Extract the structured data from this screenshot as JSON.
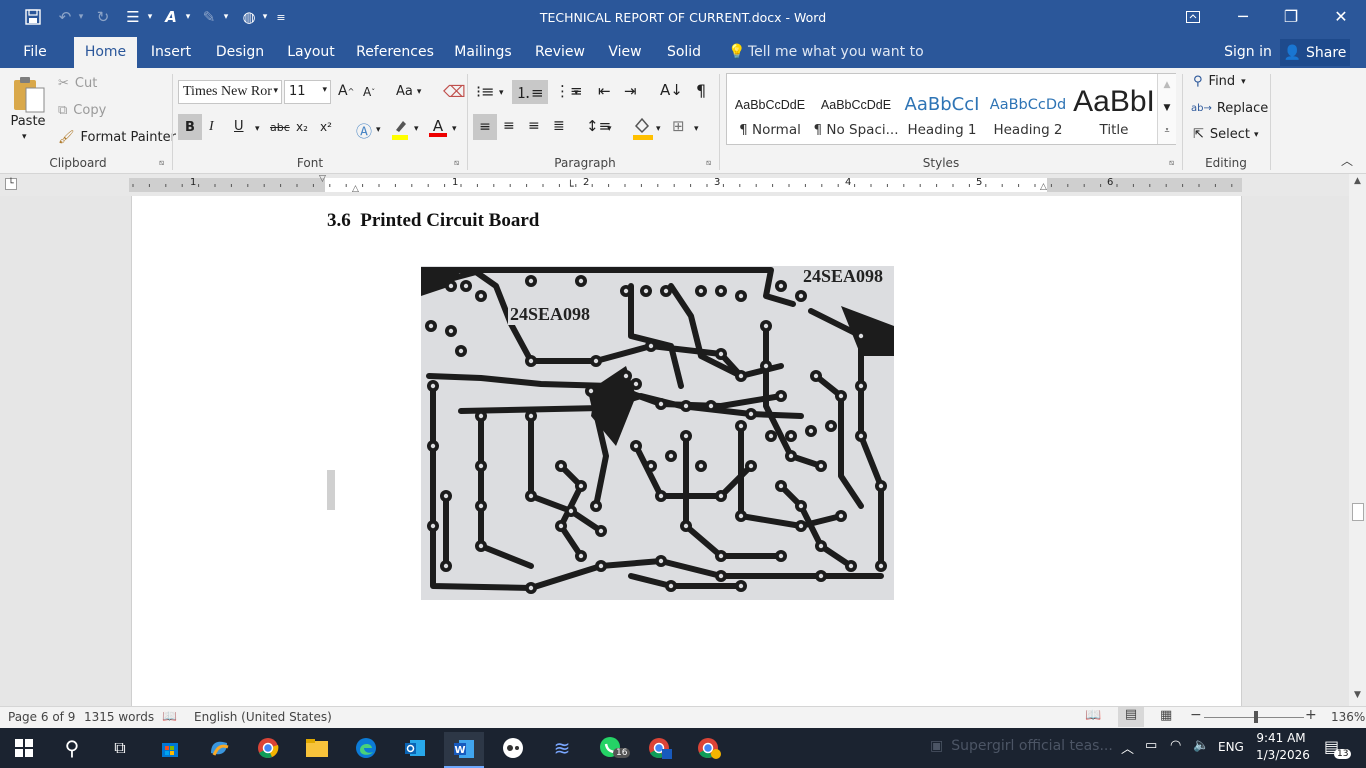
{
  "window": {
    "title": "TECHNICAL REPORT OF CURRENT.docx - Word"
  },
  "tabs": [
    {
      "label": "File"
    },
    {
      "label": "Home"
    },
    {
      "label": "Insert"
    },
    {
      "label": "Design"
    },
    {
      "label": "Layout"
    },
    {
      "label": "References"
    },
    {
      "label": "Mailings"
    },
    {
      "label": "Review"
    },
    {
      "label": "View"
    },
    {
      "label": "Solid"
    }
  ],
  "tellme": "Tell me what you want to do...",
  "signin": "Sign in",
  "share": "Share",
  "clipboard": {
    "paste": "Paste",
    "cut": "Cut",
    "copy": "Copy",
    "format_painter": "Format Painter",
    "label": "Clipboard"
  },
  "font": {
    "name": "Times New Ror",
    "size": "11",
    "change_case": "Aa",
    "label": "Font",
    "bold": "B",
    "italic": "I",
    "underline": "U",
    "strike": "abc",
    "sub": "x₂",
    "sup": "x²"
  },
  "paragraph": {
    "label": "Paragraph"
  },
  "styles": {
    "label": "Styles",
    "items": [
      {
        "preview": "AaBbCcDdE",
        "name": "¶ Normal"
      },
      {
        "preview": "AaBbCcDdE",
        "name": "¶ No Spaci..."
      },
      {
        "preview": "AaBbCcI",
        "name": "Heading 1"
      },
      {
        "preview": "AaBbCcDd",
        "name": "Heading 2"
      },
      {
        "preview": "AaBbI",
        "name": "Title"
      }
    ]
  },
  "editing": {
    "find": "Find",
    "replace": "Replace",
    "select": "Select",
    "label": "Editing"
  },
  "ruler": {
    "numbers": [
      "1",
      "1",
      "2",
      "3",
      "4",
      "5",
      "6"
    ]
  },
  "document": {
    "heading": "3.6  Printed Circuit Board",
    "pcb_labels": [
      "24SEA098",
      "24SEA098"
    ]
  },
  "status": {
    "page": "Page 6 of 9",
    "words": "1315 words",
    "language": "English (United States)",
    "zoom": "136%"
  },
  "taskbar": {
    "notification_text": "Supergirl official teas...",
    "lang": "ENG",
    "time": "9:41 AM",
    "date": "1/3/2026",
    "whatsapp_badge": "16",
    "action_center_badge": "13"
  },
  "colors": {
    "word_blue": "#2b579a",
    "taskbar": "#1b2330",
    "ribbon": "#f3f3f3"
  }
}
